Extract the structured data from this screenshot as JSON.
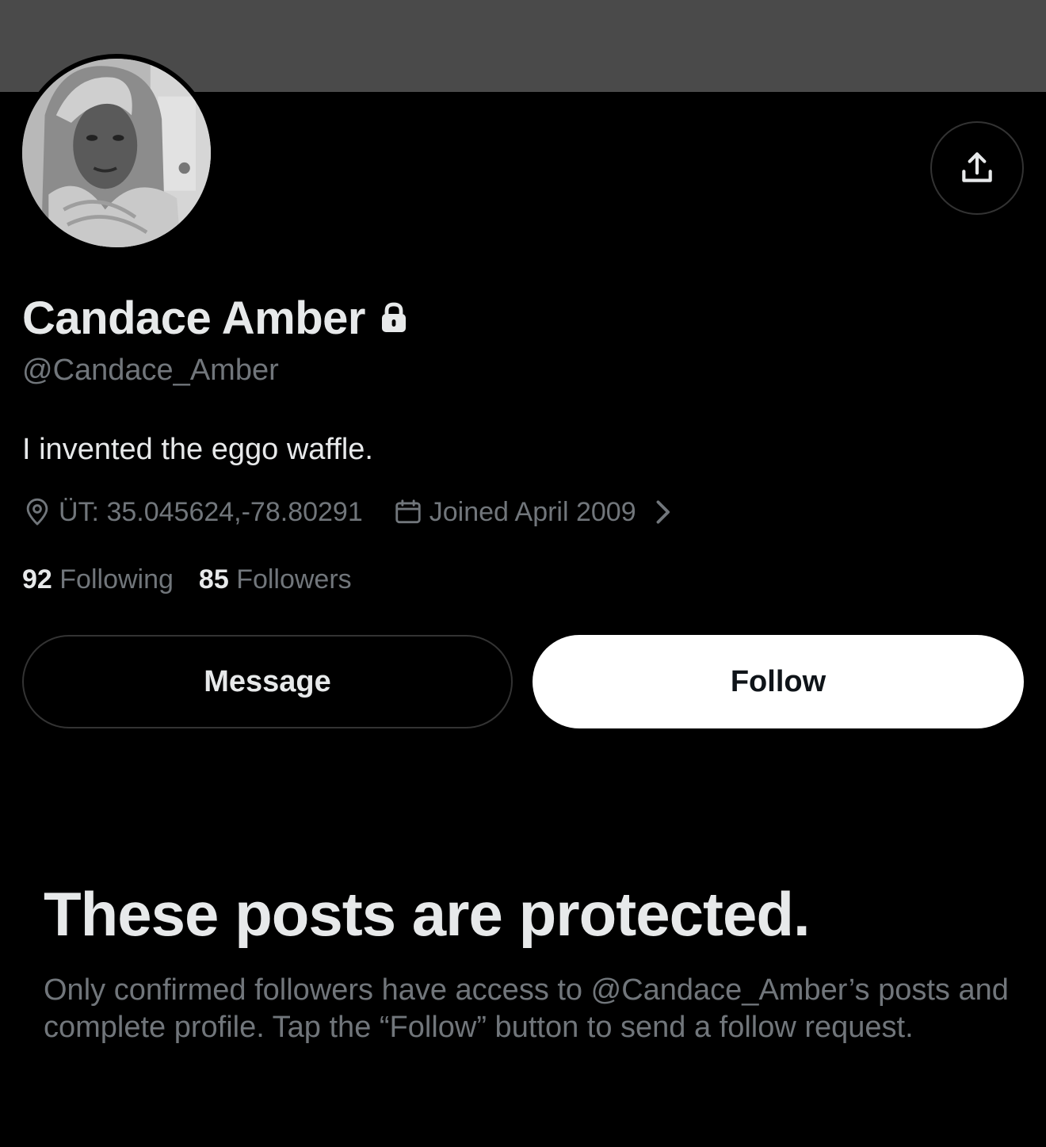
{
  "profile": {
    "display_name": "Candace Amber",
    "handle": "@Candace_Amber",
    "bio": "I invented the eggo waffle.",
    "location": "ÜT: 35.045624,-78.80291",
    "joined": "Joined April 2009",
    "following_count": "92",
    "following_label": "Following",
    "followers_count": "85",
    "followers_label": "Followers"
  },
  "actions": {
    "message_label": "Message",
    "follow_label": "Follow"
  },
  "protected": {
    "title": "These posts are protected.",
    "description": "Only confirmed followers have access to @Candace_Amber’s posts and complete profile. Tap the “Follow” button to send a follow request."
  },
  "icons": {
    "share": "share-icon",
    "lock": "lock-icon",
    "location": "location-pin-icon",
    "calendar": "calendar-icon",
    "chevron": "chevron-right-icon"
  },
  "colors": {
    "background": "#000000",
    "banner": "#4a4a4a",
    "primary_text": "#e7e9ea",
    "secondary_text": "#71767b",
    "follow_button_bg": "#ffffff"
  }
}
